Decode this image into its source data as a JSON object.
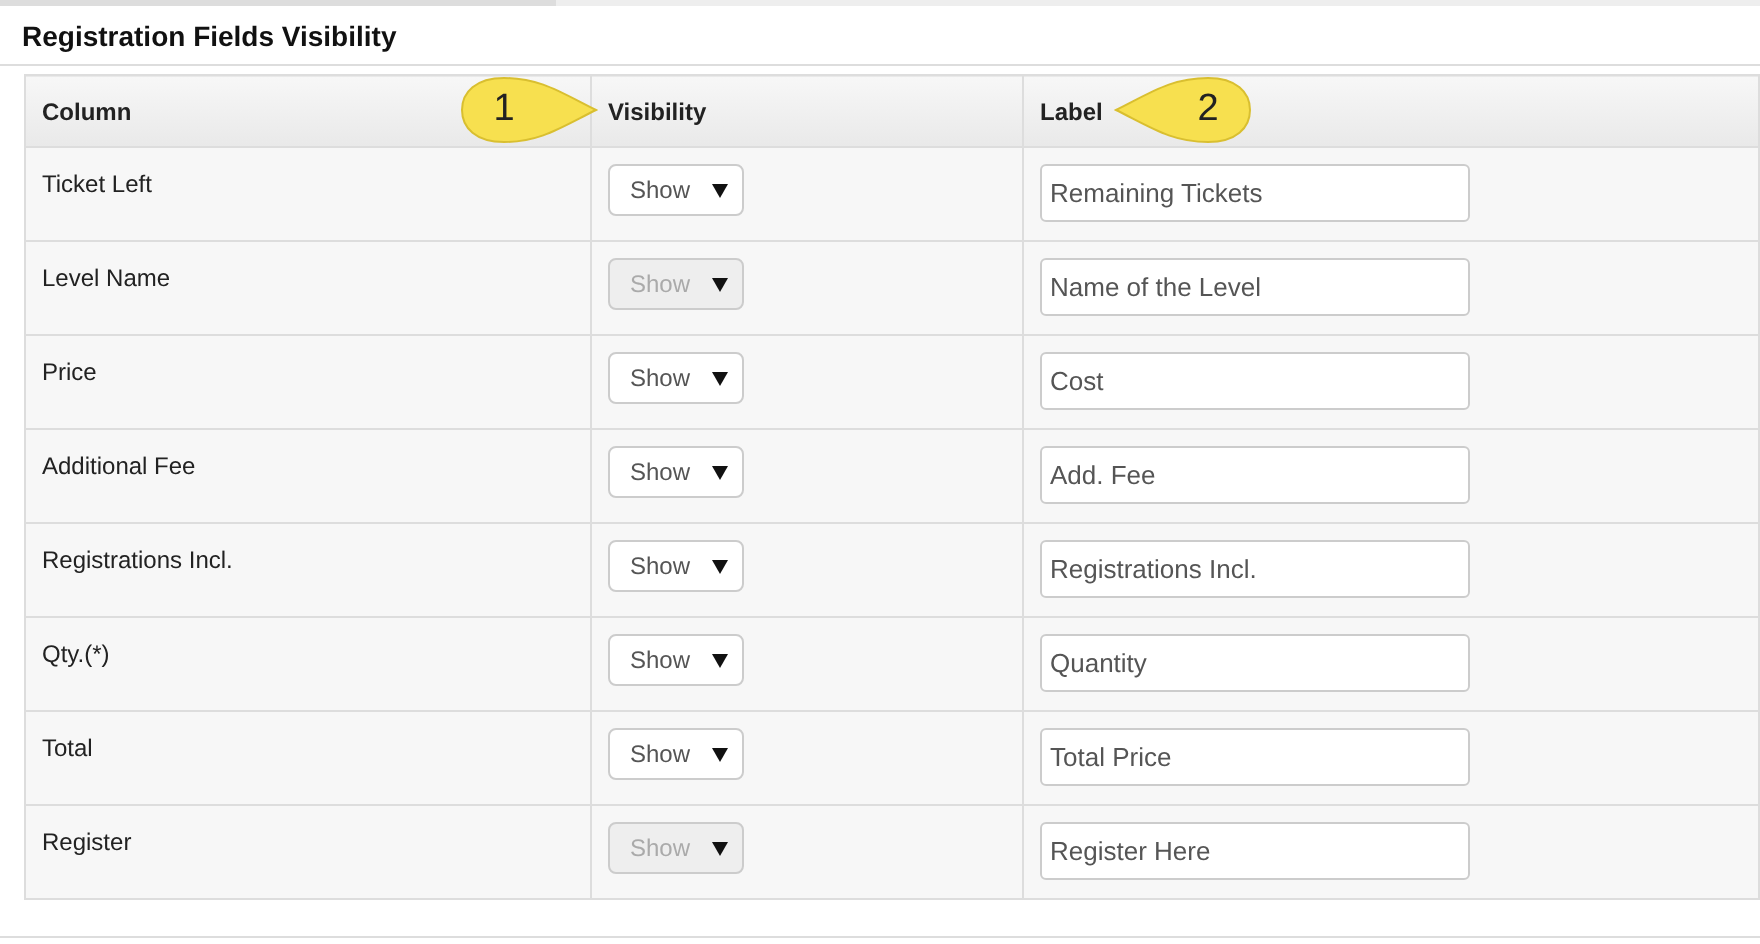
{
  "panel": {
    "title": "Registration Fields Visibility"
  },
  "table": {
    "columns": [
      "Column",
      "Visibility",
      "Label"
    ],
    "rows": [
      {
        "column": "Ticket Left",
        "visibility": "Show",
        "disabled": false,
        "label": "Remaining Tickets"
      },
      {
        "column": "Level Name",
        "visibility": "Show",
        "disabled": true,
        "label": "Name of the Level"
      },
      {
        "column": "Price",
        "visibility": "Show",
        "disabled": false,
        "label": "Cost"
      },
      {
        "column": "Additional Fee",
        "visibility": "Show",
        "disabled": false,
        "label": "Add. Fee"
      },
      {
        "column": "Registrations Incl.",
        "visibility": "Show",
        "disabled": false,
        "label": "Registrations Incl."
      },
      {
        "column": "Qty.(*)",
        "visibility": "Show",
        "disabled": false,
        "label": "Quantity"
      },
      {
        "column": "Total",
        "visibility": "Show",
        "disabled": false,
        "label": "Total Price"
      },
      {
        "column": "Register",
        "visibility": "Show",
        "disabled": true,
        "label": "Register Here"
      }
    ]
  },
  "callouts": [
    {
      "text": "1",
      "kind": "right"
    },
    {
      "text": "2",
      "kind": "left"
    }
  ]
}
